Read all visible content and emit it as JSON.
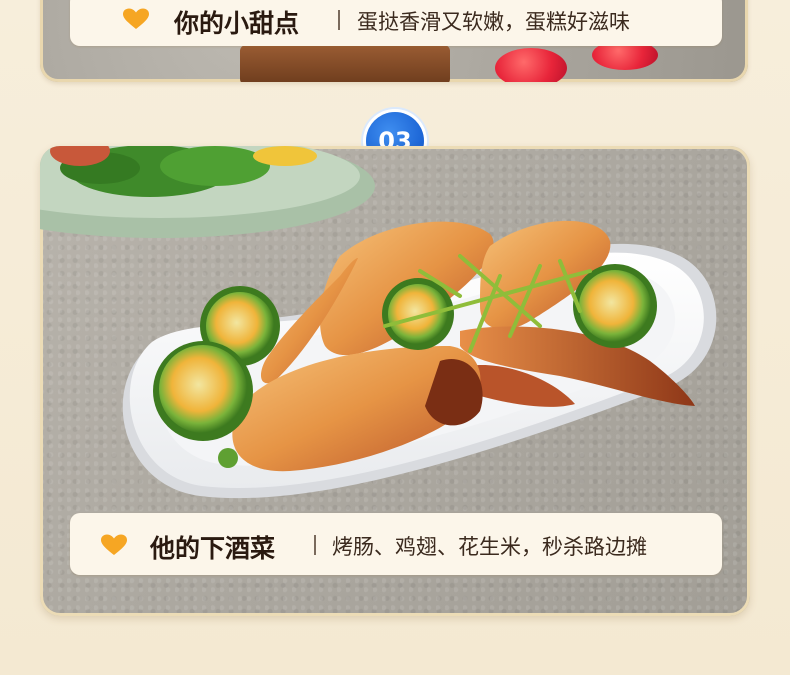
{
  "top_section": {
    "title": "你的小甜点",
    "subtitle": "蛋挞香滑又软嫩，蛋糕好滋味"
  },
  "step": {
    "number": "03"
  },
  "main_section": {
    "title": "他的下酒菜",
    "subtitle": "烤肠、鸡翅、花生米，秒杀路边摊"
  },
  "colors": {
    "heart": "#f6a623",
    "badge": "#1a63d4",
    "banner_bg": "#fcf6ea",
    "page_bg": "#f6ecd6"
  },
  "icons": {
    "heart": "heart-icon"
  }
}
